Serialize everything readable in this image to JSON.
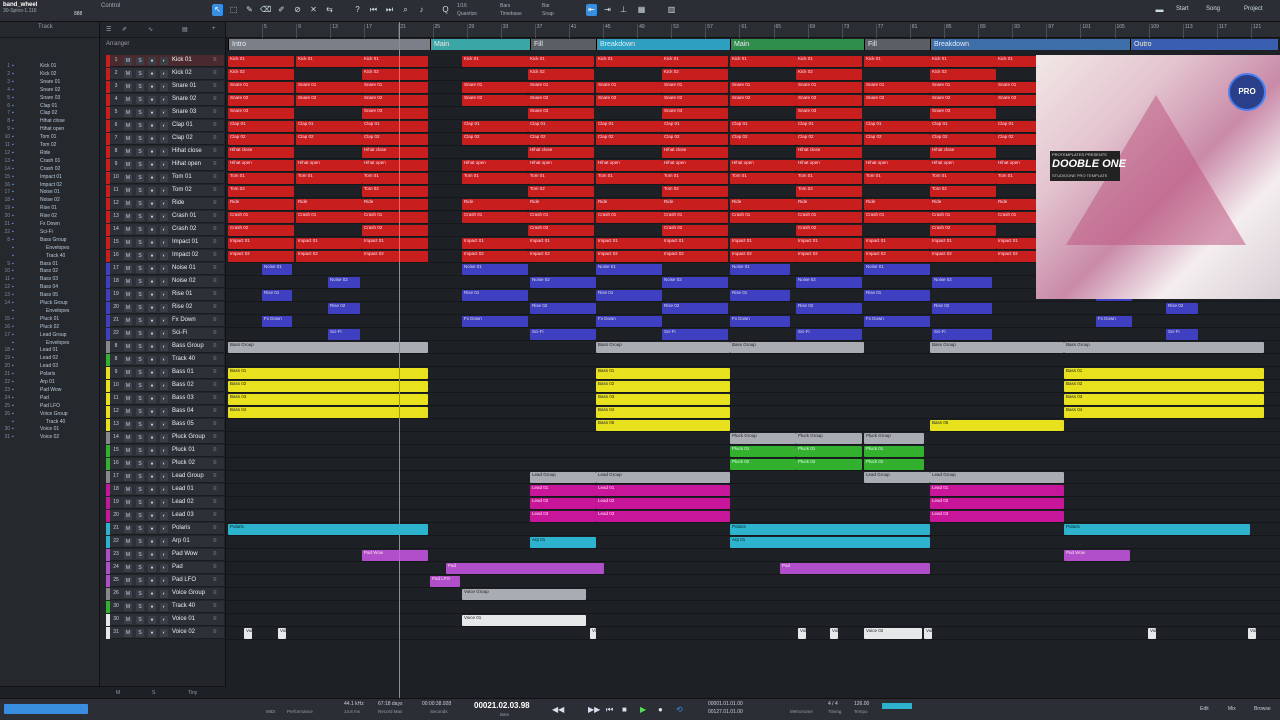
{
  "toolbar": {
    "song_name": "band_wheel",
    "song_sub": "30-Spins-1.116",
    "zoom_val": "888",
    "control_label": "Control",
    "quantize_label": "Quantize",
    "quantize_val": "1/16",
    "timebase_label": "Timebase",
    "timebase_val": "Bars",
    "snap_label": "Snap",
    "snap_val": "Bar",
    "start_label": "Start",
    "song_label": "Song",
    "project_label": "Project"
  },
  "tracklist": {
    "header": "Track",
    "items": [
      {
        "num": "1",
        "name": "Kick 01"
      },
      {
        "num": "2",
        "name": "Kick 02"
      },
      {
        "num": "3",
        "name": "Snare 01"
      },
      {
        "num": "4",
        "name": "Snare 02"
      },
      {
        "num": "5",
        "name": "Snare 03"
      },
      {
        "num": "6",
        "name": "Clap 01"
      },
      {
        "num": "7",
        "name": "Clap 02"
      },
      {
        "num": "8",
        "name": "Hihat close"
      },
      {
        "num": "9",
        "name": "Hihat open"
      },
      {
        "num": "10",
        "name": "Tom 01"
      },
      {
        "num": "11",
        "name": "Tom 02"
      },
      {
        "num": "12",
        "name": "Ride"
      },
      {
        "num": "13",
        "name": "Crash 01"
      },
      {
        "num": "14",
        "name": "Crash 02"
      },
      {
        "num": "15",
        "name": "Impact 01"
      },
      {
        "num": "16",
        "name": "Impact 02"
      },
      {
        "num": "17",
        "name": "Noise 01"
      },
      {
        "num": "18",
        "name": "Noise 02"
      },
      {
        "num": "19",
        "name": "Rise 01"
      },
      {
        "num": "20",
        "name": "Rise 02"
      },
      {
        "num": "21",
        "name": "Fx Down"
      },
      {
        "num": "22",
        "name": "Sci-Fi"
      },
      {
        "num": "8",
        "name": "Bass Group"
      },
      {
        "num": "",
        "name": "Envelopes"
      },
      {
        "num": "",
        "name": "Track 40"
      },
      {
        "num": "9",
        "name": "Bass 01"
      },
      {
        "num": "10",
        "name": "Bass 02"
      },
      {
        "num": "11",
        "name": "Bass 03"
      },
      {
        "num": "12",
        "name": "Bass 04"
      },
      {
        "num": "13",
        "name": "Bass 05"
      },
      {
        "num": "14",
        "name": "Pluck Group"
      },
      {
        "num": "",
        "name": "Envelopes"
      },
      {
        "num": "15",
        "name": "Pluck 01"
      },
      {
        "num": "16",
        "name": "Pluck 02"
      },
      {
        "num": "17",
        "name": "Lead Group"
      },
      {
        "num": "",
        "name": "Envelopes"
      },
      {
        "num": "18",
        "name": "Lead 01"
      },
      {
        "num": "19",
        "name": "Lead 02"
      },
      {
        "num": "20",
        "name": "Lead 03"
      },
      {
        "num": "21",
        "name": "Polaris"
      },
      {
        "num": "22",
        "name": "Arp 01"
      },
      {
        "num": "23",
        "name": "Pad Wow"
      },
      {
        "num": "24",
        "name": "Pad"
      },
      {
        "num": "25",
        "name": "Pad LFO"
      },
      {
        "num": "26",
        "name": "Voice Group"
      },
      {
        "num": "",
        "name": "Track 40"
      },
      {
        "num": "30",
        "name": "Voice 01"
      },
      {
        "num": "31",
        "name": "Voice 02"
      }
    ]
  },
  "inspector": {
    "title": "Arranger",
    "footer_m": "M",
    "footer_s": "S",
    "footer_tiny": "Tiny"
  },
  "tracks": [
    {
      "n": "1",
      "name": "Kick 01",
      "color": "#c81e1e",
      "sel": true
    },
    {
      "n": "2",
      "name": "Kick 02",
      "color": "#c81e1e"
    },
    {
      "n": "3",
      "name": "Snare 01",
      "color": "#c81e1e"
    },
    {
      "n": "4",
      "name": "Snare 02",
      "color": "#c81e1e"
    },
    {
      "n": "5",
      "name": "Snare 03",
      "color": "#c81e1e"
    },
    {
      "n": "6",
      "name": "Clap 01",
      "color": "#c81e1e"
    },
    {
      "n": "7",
      "name": "Clap 02",
      "color": "#c81e1e"
    },
    {
      "n": "8",
      "name": "Hihat close",
      "color": "#c81e1e"
    },
    {
      "n": "9",
      "name": "Hihat open",
      "color": "#c81e1e"
    },
    {
      "n": "10",
      "name": "Tom 01",
      "color": "#c81e1e"
    },
    {
      "n": "11",
      "name": "Tom 02",
      "color": "#c81e1e"
    },
    {
      "n": "12",
      "name": "Ride",
      "color": "#c81e1e"
    },
    {
      "n": "13",
      "name": "Crash 01",
      "color": "#c81e1e"
    },
    {
      "n": "14",
      "name": "Crash 02",
      "color": "#c81e1e"
    },
    {
      "n": "15",
      "name": "Impact 01",
      "color": "#c81e1e"
    },
    {
      "n": "16",
      "name": "Impact 02",
      "color": "#c81e1e"
    },
    {
      "n": "17",
      "name": "Noise 01",
      "color": "#3f3fc2"
    },
    {
      "n": "18",
      "name": "Noise 02",
      "color": "#3f3fc2"
    },
    {
      "n": "19",
      "name": "Rise 01",
      "color": "#3f3fc2"
    },
    {
      "n": "20",
      "name": "Rise 02",
      "color": "#3f3fc2"
    },
    {
      "n": "21",
      "name": "Fx Down",
      "color": "#3f3fc2"
    },
    {
      "n": "22",
      "name": "Sci-Fi",
      "color": "#3f3fc2"
    },
    {
      "n": "8",
      "name": "Bass Group",
      "color": "#888"
    },
    {
      "n": "8",
      "name": "Track 40",
      "color": "#33b02e"
    },
    {
      "n": "9",
      "name": "Bass 01",
      "color": "#e8e21e"
    },
    {
      "n": "10",
      "name": "Bass 02",
      "color": "#e8e21e"
    },
    {
      "n": "11",
      "name": "Bass 03",
      "color": "#e8e21e"
    },
    {
      "n": "12",
      "name": "Bass 04",
      "color": "#e8e21e"
    },
    {
      "n": "13",
      "name": "Bass 05",
      "color": "#e8e21e"
    },
    {
      "n": "14",
      "name": "Pluck Group",
      "color": "#888"
    },
    {
      "n": "15",
      "name": "Pluck 01",
      "color": "#33b02e"
    },
    {
      "n": "16",
      "name": "Pluck 02",
      "color": "#33b02e"
    },
    {
      "n": "17",
      "name": "Lead Group",
      "color": "#888"
    },
    {
      "n": "18",
      "name": "Lead 01",
      "color": "#c7169a"
    },
    {
      "n": "19",
      "name": "Lead 02",
      "color": "#c7169a"
    },
    {
      "n": "20",
      "name": "Lead 03",
      "color": "#c7169a"
    },
    {
      "n": "21",
      "name": "Polaris",
      "color": "#2eb3cf"
    },
    {
      "n": "22",
      "name": "Arp 01",
      "color": "#2eb3cf"
    },
    {
      "n": "23",
      "name": "Pad Wow",
      "color": "#b14ec9"
    },
    {
      "n": "24",
      "name": "Pad",
      "color": "#b14ec9"
    },
    {
      "n": "25",
      "name": "Pad LFO",
      "color": "#b14ec9"
    },
    {
      "n": "26",
      "name": "Voice Group",
      "color": "#888"
    },
    {
      "n": "30",
      "name": "Track 40",
      "color": "#33b02e"
    },
    {
      "n": "30",
      "name": "Voice 01",
      "color": "#e6e8ea"
    },
    {
      "n": "31",
      "name": "Voice 02",
      "color": "#e6e8ea"
    }
  ],
  "ruler": [
    "5",
    "9",
    "13",
    "17",
    "21",
    "25",
    "29",
    "33",
    "37",
    "41",
    "45",
    "49",
    "53",
    "57",
    "61",
    "65",
    "69",
    "73",
    "77",
    "81",
    "85",
    "89",
    "93",
    "97",
    "101",
    "105",
    "109",
    "113",
    "117",
    "121"
  ],
  "markers": [
    {
      "label": "Intro",
      "color": "#7b8088"
    },
    {
      "label": "Main",
      "color": "#3aa6a6"
    },
    {
      "label": "Fill",
      "color": "#5a5f66"
    },
    {
      "label": "Breakdown",
      "color": "#2e9fc0"
    },
    {
      "label": "Main",
      "color": "#2f8f4a"
    },
    {
      "label": "Fill",
      "color": "#5a5f66"
    },
    {
      "label": "Breakdown",
      "color": "#3f6fa8"
    },
    {
      "label": "Outro",
      "color": "#3a5fb0"
    }
  ],
  "artwork": {
    "small": "PROTEMPLATES PRESENTS",
    "title": "DOOBLE ONE",
    "sub": "STUDIOONE PRO TEMPLATE",
    "logo": "PRO"
  },
  "transport": {
    "midi": "MIDI",
    "performance": "Performance",
    "sample_rate": "44.1 kHz",
    "latency": "14.8 ms",
    "record_days": "67:18 days",
    "record_max": "Record Max",
    "seconds_val": "00:00:38.928",
    "seconds_label": "Seconds",
    "bars_val": "00021.02.03.98",
    "bars_label": "Bars",
    "loop_l": "00001.01.01.00",
    "loop_r": "00127.01.01.00",
    "metronome": "Metronome",
    "timesig": "4 / 4",
    "timing": "Timing",
    "tempo": "126.00",
    "tempo_label": "Tempo",
    "edit": "Edit",
    "mix": "Mix",
    "browse": "Browse"
  }
}
